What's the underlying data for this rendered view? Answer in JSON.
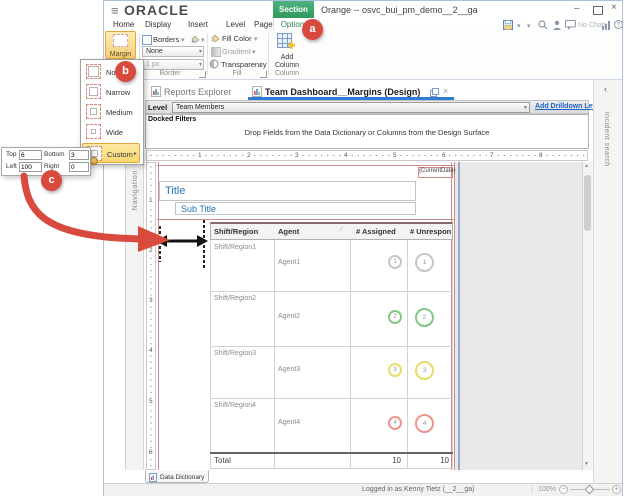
{
  "icons": {
    "hamburger": "≡",
    "minimize": "–",
    "close": "×",
    "dropdown": "▾",
    "submenu": "▸",
    "chevron_left": "‹",
    "sort": "∕",
    "scroll_up": "▲",
    "scroll_down": "▼",
    "help": "?",
    "zoom_out": "−",
    "zoom_in": "+"
  },
  "titlebar": {
    "logo": "ORACLE",
    "title": "Orange -- osvc_bui_pm_demo__2__ga",
    "section_tab": "Section",
    "no_chats_label": "No Chats"
  },
  "menu": {
    "tabs": [
      "Home",
      "Display",
      "Insert",
      "Level",
      "Page Setup"
    ],
    "options_tab": "Options"
  },
  "ribbon": {
    "margin_label": "Margin",
    "border_group": {
      "borders_label": "Borders",
      "stroke_value": "None",
      "width_value": "1 px",
      "group_label": "Border"
    },
    "fill_group": {
      "fill_color_label": "Fill Color",
      "gradient_label": "Gradient",
      "transparency_label": "Transparency",
      "group_label": "Fill"
    },
    "column_group": {
      "add_column_label": "Add Column",
      "group_label": "Column"
    }
  },
  "margin_menu": {
    "items": [
      "None",
      "Narrow",
      "Medium",
      "Wide",
      "Custom"
    ],
    "highlighted_item": "Custom"
  },
  "custom_margins": {
    "top_label": "Top",
    "top_value": "6",
    "bottom_label": "Bottom",
    "bottom_value": "3",
    "left_label": "Left",
    "left_value": "100",
    "right_label": "Right",
    "right_value": "0"
  },
  "callouts": {
    "a": "a",
    "b": "b",
    "c": "c"
  },
  "workspace": {
    "tabs": [
      {
        "label": "Reports Explorer"
      },
      {
        "label": "Team Dashboard__Margins (Design)"
      }
    ],
    "level_label": "Level",
    "level_value": "Team Members",
    "add_drilldown_link": "Add Drilldown Level",
    "docked_filters_label": "Docked Filters",
    "docked_filters_hint": "Drop Fields from the Data Dictionary or Columns from the Design Surface",
    "left_panel_label": "Navigation",
    "right_panel_label": "incident search"
  },
  "canvas": {
    "current_date": "{CurrentDate}",
    "title": "Title",
    "subtitle": "Sub Title",
    "h_ruler": [
      "1",
      "2",
      "3",
      "4",
      "5",
      "6",
      "7",
      "8"
    ],
    "v_ruler": [
      "1",
      "2",
      "3",
      "4",
      "5",
      "6"
    ],
    "table": {
      "headers": [
        "Shift/Region",
        "Agent",
        "# Assigned",
        "# Unrespon"
      ],
      "rows": [
        {
          "region": "Shift/Region1",
          "agent": "Agent1",
          "assigned": "1",
          "unresponded": "1",
          "ring": "#c3c7cc"
        },
        {
          "region": "Shift/Region2",
          "agent": "Agent2",
          "assigned": "2",
          "unresponded": "2",
          "ring": "#82c784"
        },
        {
          "region": "Shift/Region3",
          "agent": "Agent3",
          "assigned": "3",
          "unresponded": "3",
          "ring": "#e6dd6a"
        },
        {
          "region": "Shift/Region4",
          "agent": "Agent4",
          "assigned": "4",
          "unresponded": "4",
          "ring": "#ef948c"
        }
      ],
      "total_label": "Total",
      "total_assigned": "10",
      "total_unresponded": "10"
    }
  },
  "statusbar": {
    "data_dictionary_tab": "Data Dictionary",
    "logged_in": "Logged in as Kenny Tietz (__2__ga)",
    "zoom_level": "100%"
  },
  "colors": {
    "accent_green": "#35a566",
    "callout_red": "#d94a3e",
    "active_tab_blue": "#2e7cd6",
    "link_blue": "#1f62c9",
    "title_blue": "#2173b5",
    "margin_highlight": "#fbd671",
    "page_guide_red": "#cf8a8a"
  }
}
